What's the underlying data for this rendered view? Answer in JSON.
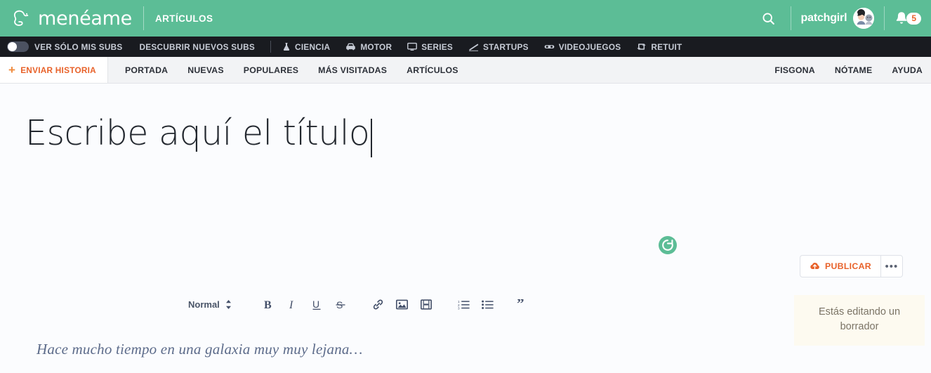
{
  "colors": {
    "brand_green": "#5cbd96",
    "dark_nav": "#191b20",
    "light_nav": "#f2f3f5",
    "accent_orange": "#e8622a",
    "plus_orange": "#f08a3c",
    "page_bg": "#fbfcfe",
    "draft_bg": "#fdfaf0",
    "toolbar_icon": "#44506a"
  },
  "header": {
    "brand_name": "menéame",
    "section_label": "ARTÍCULOS",
    "logo_icon": "meneame-logo-icon",
    "search_icon": "search-icon",
    "username": "patchgirl",
    "avatar_icon": "avatar",
    "bell_icon": "bell-icon",
    "notification_count": "5"
  },
  "dark_nav": {
    "toggle": {
      "label": "VER SÓLO MIS SUBS",
      "state": "off",
      "icon": "toggle-switch-icon"
    },
    "discover_label": "DESCUBRIR NUEVOS SUBS",
    "categories": [
      {
        "label": "CIENCIA",
        "icon": "flask-icon"
      },
      {
        "label": "MOTOR",
        "icon": "car-icon"
      },
      {
        "label": "SERIES",
        "icon": "monitor-icon"
      },
      {
        "label": "STARTUPS",
        "icon": "chart-line-icon"
      },
      {
        "label": "VIDEOJUEGOS",
        "icon": "gamepad-icon"
      },
      {
        "label": "RETUIT",
        "icon": "retweet-icon"
      }
    ]
  },
  "light_nav": {
    "send_story": {
      "label": "ENVIAR HISTORIA",
      "icon": "plus-icon"
    },
    "items": [
      {
        "label": "PORTADA"
      },
      {
        "label": "NUEVAS"
      },
      {
        "label": "POPULARES"
      },
      {
        "label": "MÁS VISITADAS"
      },
      {
        "label": "ARTÍCULOS"
      }
    ],
    "right_items": [
      {
        "label": "FISGONA"
      },
      {
        "label": "NÓTAME"
      },
      {
        "label": "AYUDA"
      }
    ]
  },
  "editor": {
    "title_placeholder": "Escribe aquí el título",
    "sync_icon": "sync-refresh-icon",
    "toolbar": {
      "style_select": {
        "value": "Normal",
        "icon": "up-down-chevron-icon"
      },
      "buttons": [
        {
          "name": "bold-button",
          "glyph": "B"
        },
        {
          "name": "italic-button",
          "glyph": "I"
        },
        {
          "name": "underline-button",
          "glyph": "U"
        },
        {
          "name": "strikethrough-button",
          "glyph": "S"
        },
        {
          "name": "link-button",
          "glyph": "link-icon"
        },
        {
          "name": "image-button",
          "glyph": "image-icon"
        },
        {
          "name": "video-button",
          "glyph": "film-icon"
        },
        {
          "name": "ordered-list-button",
          "glyph": "ordered-list-icon"
        },
        {
          "name": "unordered-list-button",
          "glyph": "unordered-list-icon"
        },
        {
          "name": "blockquote-button",
          "glyph": "quote-icon"
        }
      ]
    },
    "body_placeholder": "Hace mucho tiempo en una galaxia muy muy lejana…"
  },
  "sidebar": {
    "publish_label": "PUBLICAR",
    "publish_icon": "cloud-upload-icon",
    "more_label": "•••",
    "draft_notice": "Estás editando un borrador"
  }
}
